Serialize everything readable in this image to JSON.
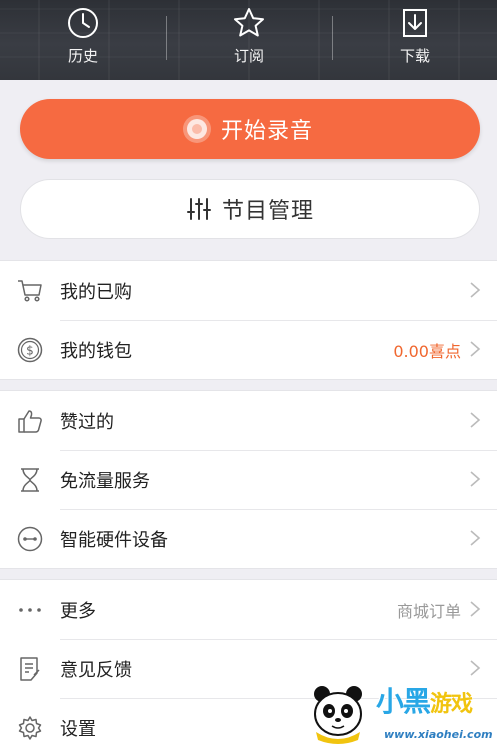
{
  "top_nav": {
    "items": [
      {
        "label": "历史",
        "icon": "clock-icon"
      },
      {
        "label": "订阅",
        "icon": "star-icon"
      },
      {
        "label": "下载",
        "icon": "download-icon"
      }
    ]
  },
  "actions": {
    "record_label": "开始录音",
    "manage_label": "节目管理"
  },
  "group1": [
    {
      "label": "我的已购",
      "icon": "cart-icon",
      "right": ""
    },
    {
      "label": "我的钱包",
      "icon": "coin-icon",
      "right": "0.00喜点"
    }
  ],
  "group2": [
    {
      "label": "赞过的",
      "icon": "thumbs-up-icon",
      "right": ""
    },
    {
      "label": "免流量服务",
      "icon": "hourglass-icon",
      "right": ""
    },
    {
      "label": "智能硬件设备",
      "icon": "device-icon",
      "right": ""
    }
  ],
  "group3": [
    {
      "label": "更多",
      "icon": "more-dots-icon",
      "right": "商城订单"
    },
    {
      "label": "意见反馈",
      "icon": "feedback-icon",
      "right": ""
    },
    {
      "label": "设置",
      "icon": "gear-icon",
      "right": ""
    }
  ],
  "watermark": {
    "title_main": "小黑",
    "title_sub": "游戏",
    "url": "www.xiaohei.com"
  },
  "colors": {
    "accent": "#f66a41",
    "wallet_value": "#f0672f",
    "header_bg": "#33363c",
    "page_bg": "#efeef3"
  }
}
